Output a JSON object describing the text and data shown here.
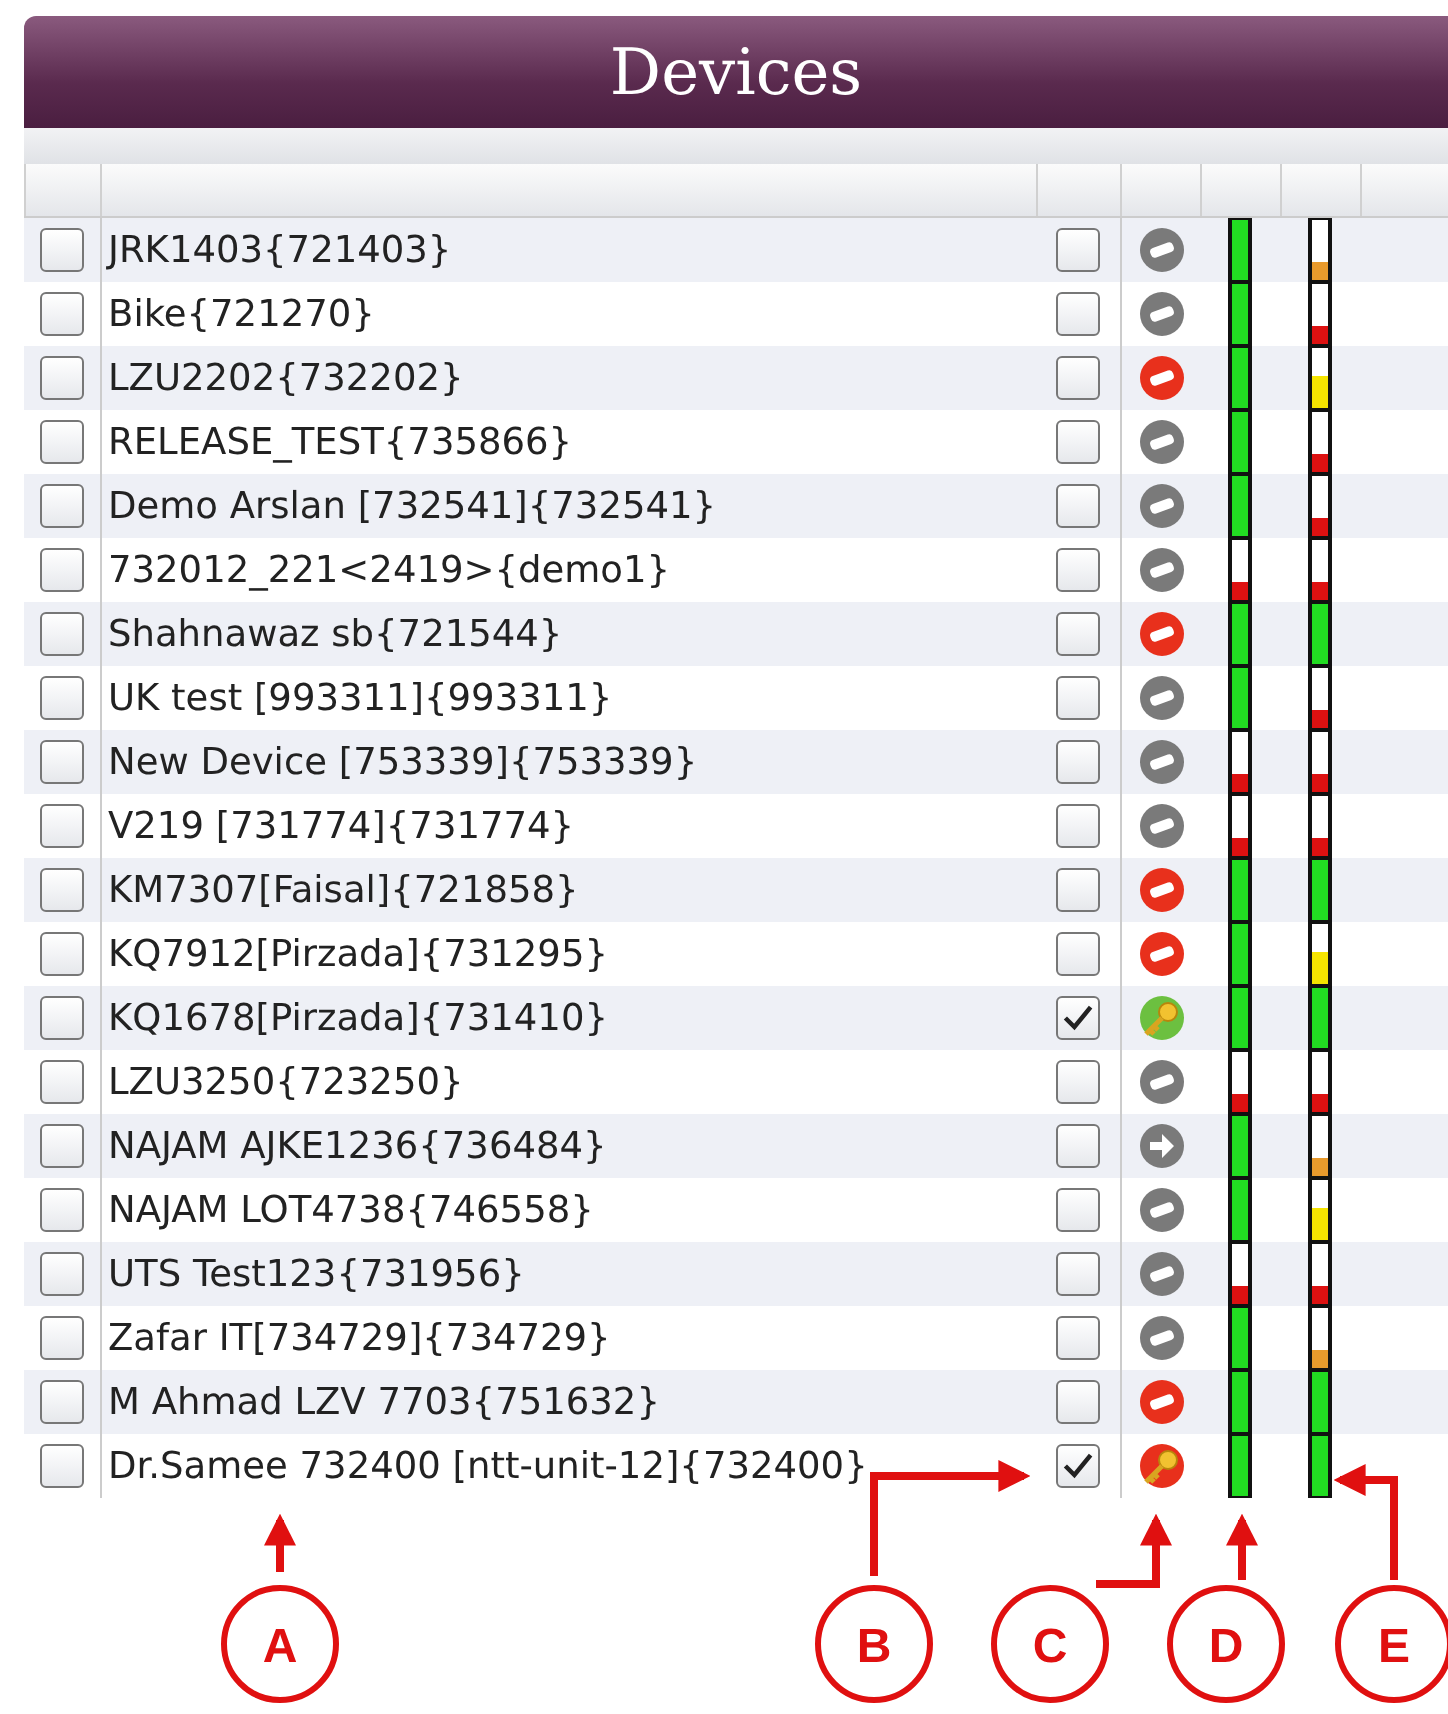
{
  "title": "Devices",
  "devices": [
    {
      "name": "JRK1403{721403}",
      "selected": false,
      "checked": false,
      "icon": {
        "kind": "minus",
        "color": "#7a7a7a"
      },
      "bar_d": {
        "level": 1,
        "color": "#22dd22"
      },
      "bar_e": {
        "level": 0.3,
        "color": "#e89a2c"
      }
    },
    {
      "name": "Bike{721270}",
      "selected": false,
      "checked": false,
      "icon": {
        "kind": "minus",
        "color": "#7a7a7a"
      },
      "bar_d": {
        "level": 1,
        "color": "#22dd22"
      },
      "bar_e": {
        "level": 0.3,
        "color": "#dd1111"
      }
    },
    {
      "name": "LZU2202{732202}",
      "selected": false,
      "checked": false,
      "icon": {
        "kind": "minus",
        "color": "#e8301c"
      },
      "bar_d": {
        "level": 1,
        "color": "#22dd22"
      },
      "bar_e": {
        "level": 0.55,
        "color": "#f5e400"
      }
    },
    {
      "name": "RELEASE_TEST{735866}",
      "selected": false,
      "checked": false,
      "icon": {
        "kind": "minus",
        "color": "#7a7a7a"
      },
      "bar_d": {
        "level": 1,
        "color": "#22dd22"
      },
      "bar_e": {
        "level": 0.3,
        "color": "#dd1111"
      }
    },
    {
      "name": "Demo Arslan [732541]{732541}",
      "selected": false,
      "checked": false,
      "icon": {
        "kind": "minus",
        "color": "#7a7a7a"
      },
      "bar_d": {
        "level": 1,
        "color": "#22dd22"
      },
      "bar_e": {
        "level": 0.3,
        "color": "#dd1111"
      }
    },
    {
      "name": "732012_221<2419>{demo1}",
      "selected": false,
      "checked": false,
      "icon": {
        "kind": "minus",
        "color": "#7a7a7a"
      },
      "bar_d": {
        "level": 0.3,
        "color": "#dd1111"
      },
      "bar_e": {
        "level": 0.3,
        "color": "#dd1111"
      }
    },
    {
      "name": "Shahnawaz sb{721544}",
      "selected": false,
      "checked": false,
      "icon": {
        "kind": "minus",
        "color": "#e8301c"
      },
      "bar_d": {
        "level": 1,
        "color": "#22dd22"
      },
      "bar_e": {
        "level": 1,
        "color": "#22dd22"
      }
    },
    {
      "name": "UK test [993311]{993311}",
      "selected": false,
      "checked": false,
      "icon": {
        "kind": "minus",
        "color": "#7a7a7a"
      },
      "bar_d": {
        "level": 1,
        "color": "#22dd22"
      },
      "bar_e": {
        "level": 0.3,
        "color": "#dd1111"
      }
    },
    {
      "name": "New Device [753339]{753339}",
      "selected": false,
      "checked": false,
      "icon": {
        "kind": "minus",
        "color": "#7a7a7a"
      },
      "bar_d": {
        "level": 0.3,
        "color": "#dd1111"
      },
      "bar_e": {
        "level": 0.3,
        "color": "#dd1111"
      }
    },
    {
      "name": "V219 [731774]{731774}",
      "selected": false,
      "checked": false,
      "icon": {
        "kind": "minus",
        "color": "#7a7a7a"
      },
      "bar_d": {
        "level": 0.3,
        "color": "#dd1111"
      },
      "bar_e": {
        "level": 0.3,
        "color": "#dd1111"
      }
    },
    {
      "name": "KM7307[Faisal]{721858}",
      "selected": false,
      "checked": false,
      "icon": {
        "kind": "minus",
        "color": "#e8301c"
      },
      "bar_d": {
        "level": 1,
        "color": "#22dd22"
      },
      "bar_e": {
        "level": 1,
        "color": "#22dd22"
      }
    },
    {
      "name": "KQ7912[Pirzada]{731295}",
      "selected": false,
      "checked": false,
      "icon": {
        "kind": "minus",
        "color": "#e8301c"
      },
      "bar_d": {
        "level": 1,
        "color": "#22dd22"
      },
      "bar_e": {
        "level": 0.55,
        "color": "#f5e400"
      }
    },
    {
      "name": "KQ1678[Pirzada]{731410}",
      "selected": false,
      "checked": true,
      "icon": {
        "kind": "key",
        "color": "#6cc040"
      },
      "bar_d": {
        "level": 1,
        "color": "#22dd22"
      },
      "bar_e": {
        "level": 1,
        "color": "#22dd22"
      }
    },
    {
      "name": "LZU3250{723250}",
      "selected": false,
      "checked": false,
      "icon": {
        "kind": "minus",
        "color": "#7a7a7a"
      },
      "bar_d": {
        "level": 0.3,
        "color": "#dd1111"
      },
      "bar_e": {
        "level": 0.3,
        "color": "#dd1111"
      }
    },
    {
      "name": "NAJAM AJKE1236{736484}",
      "selected": false,
      "checked": false,
      "icon": {
        "kind": "arrow",
        "color": "#7a7a7a"
      },
      "bar_d": {
        "level": 1,
        "color": "#22dd22"
      },
      "bar_e": {
        "level": 0.3,
        "color": "#e89a2c"
      }
    },
    {
      "name": "NAJAM LOT4738{746558}",
      "selected": false,
      "checked": false,
      "icon": {
        "kind": "minus",
        "color": "#7a7a7a"
      },
      "bar_d": {
        "level": 1,
        "color": "#22dd22"
      },
      "bar_e": {
        "level": 0.55,
        "color": "#f5e400"
      }
    },
    {
      "name": "UTS Test123{731956}",
      "selected": false,
      "checked": false,
      "icon": {
        "kind": "minus",
        "color": "#7a7a7a"
      },
      "bar_d": {
        "level": 0.3,
        "color": "#dd1111"
      },
      "bar_e": {
        "level": 0.3,
        "color": "#dd1111"
      }
    },
    {
      "name": "Zafar IT[734729]{734729}",
      "selected": false,
      "checked": false,
      "icon": {
        "kind": "minus",
        "color": "#7a7a7a"
      },
      "bar_d": {
        "level": 1,
        "color": "#22dd22"
      },
      "bar_e": {
        "level": 0.3,
        "color": "#e89a2c"
      }
    },
    {
      "name": "M Ahmad LZV 7703{751632}",
      "selected": false,
      "checked": false,
      "icon": {
        "kind": "minus",
        "color": "#e8301c"
      },
      "bar_d": {
        "level": 1,
        "color": "#22dd22"
      },
      "bar_e": {
        "level": 1,
        "color": "#22dd22"
      }
    },
    {
      "name": "Dr.Samee 732400 [ntt-unit-12]{732400}",
      "selected": false,
      "checked": true,
      "icon": {
        "kind": "key",
        "color": "#e8301c"
      },
      "bar_d": {
        "level": 1,
        "color": "#22dd22"
      },
      "bar_e": {
        "level": 1,
        "color": "#22dd22"
      }
    }
  ],
  "callouts": [
    {
      "label": "A"
    },
    {
      "label": "B"
    },
    {
      "label": "C"
    },
    {
      "label": "D"
    },
    {
      "label": "E"
    }
  ]
}
